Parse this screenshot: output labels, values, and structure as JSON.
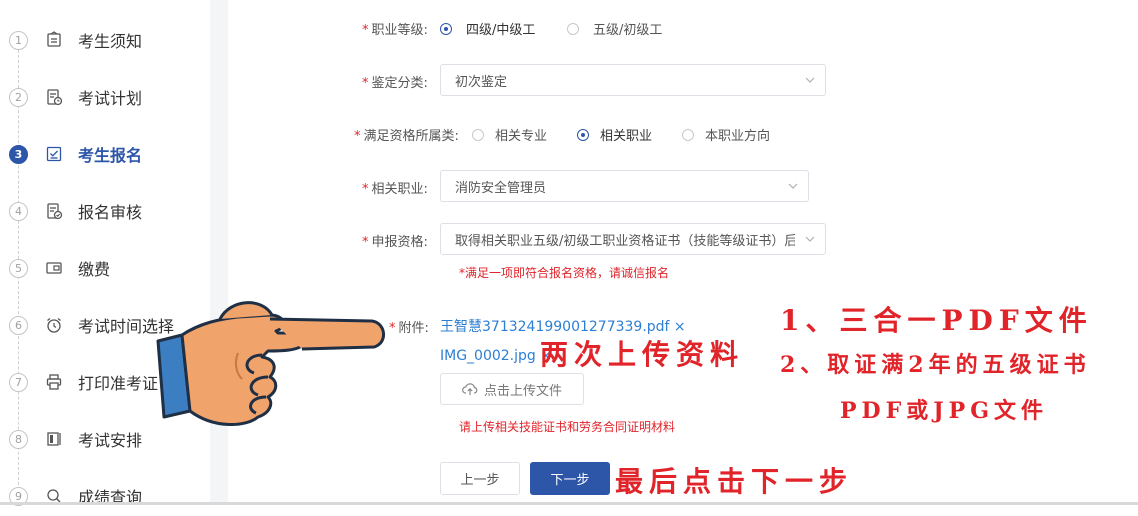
{
  "sidebar": {
    "steps": [
      {
        "num": "1",
        "label": "考生须知",
        "icon": "notice-icon"
      },
      {
        "num": "2",
        "label": "考试计划",
        "icon": "plan-icon"
      },
      {
        "num": "3",
        "label": "考生报名",
        "icon": "register-icon",
        "active": true
      },
      {
        "num": "4",
        "label": "报名审核",
        "icon": "review-icon"
      },
      {
        "num": "5",
        "label": "缴费",
        "icon": "wallet-icon"
      },
      {
        "num": "6",
        "label": "考试时间选择",
        "icon": "alarm-clock-icon"
      },
      {
        "num": "7",
        "label": "打印准考证",
        "icon": "printer-icon"
      },
      {
        "num": "8",
        "label": "考试安排",
        "icon": "schedule-icon"
      },
      {
        "num": "9",
        "label": "成绩查询",
        "icon": "search-icon"
      }
    ]
  },
  "form": {
    "level": {
      "label": "职业等级:",
      "options": [
        "四级/中级工",
        "五级/初级工"
      ],
      "selected": "四级/中级工"
    },
    "category": {
      "label": "鉴定分类:",
      "value": "初次鉴定"
    },
    "qualification_type": {
      "label": "满足资格所属类:",
      "options": [
        "相关专业",
        "相关职业",
        "本职业方向"
      ],
      "selected": "相关职业"
    },
    "related_occupation": {
      "label": "相关职业:",
      "value": "消防安全管理员"
    },
    "apply_qualification": {
      "label": "申报资格:",
      "value": "取得相关职业五级/初级工职业资格证书（技能等级证书）后",
      "hint": "*满足一项即符合报名资格，请诚信报名"
    },
    "attachment": {
      "label": "附件:",
      "files": [
        "王智慧371324199001277339.pdf ×",
        "IMG_0002.jpg ×"
      ],
      "upload_label": "点击上传文件",
      "hint": "请上传相关技能证书和劳务合同证明材料"
    },
    "buttons": {
      "prev": "上一步",
      "next": "下一步"
    }
  },
  "annotations": {
    "uploaded_twice": "两次上传资料",
    "note1": "1、三合一PDF文件",
    "note2": "2、取证满2年的五级证书",
    "note3": "PDF或JPG文件",
    "final_step": "最后点击下一步"
  },
  "colors": {
    "primary": "#2d55a8",
    "required": "#e0242a",
    "link": "#2d7fd3",
    "hand_skin": "#f0a36a",
    "hand_cuff": "#3b7ec2"
  }
}
